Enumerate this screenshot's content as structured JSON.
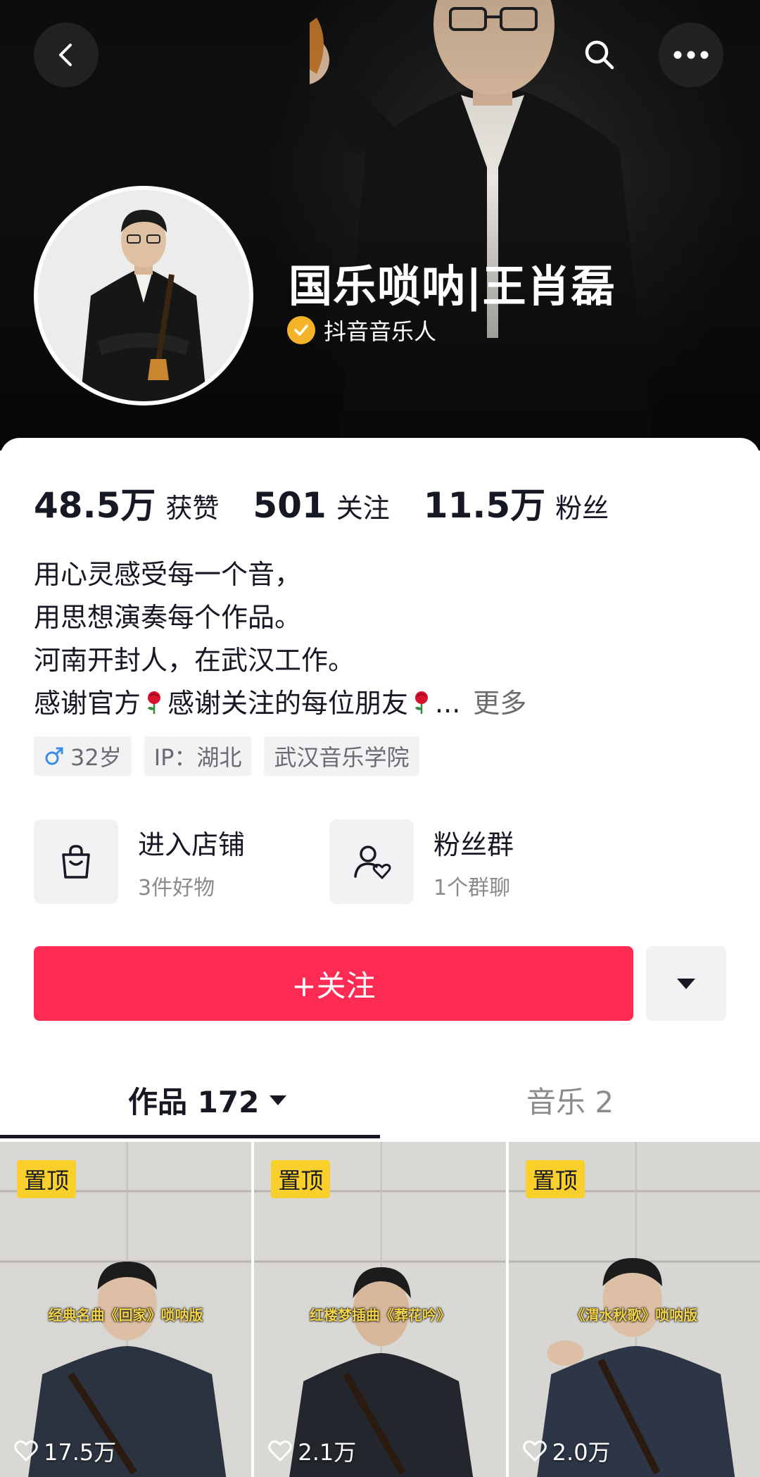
{
  "profile": {
    "name": "国乐唢呐|王肖磊",
    "verification": "抖音音乐人"
  },
  "stats": [
    {
      "value": "48.5万",
      "label": "获赞"
    },
    {
      "value": "501",
      "label": "关注"
    },
    {
      "value": "11.5万",
      "label": "粉丝"
    }
  ],
  "bio": {
    "line1": "用心灵感受每一个音，",
    "line2": "用思想演奏每个作品。",
    "line3": "河南开封人，在武汉工作。",
    "line4_a": "感谢官方",
    "line4_b": "感谢关注的每位朋友",
    "line4_c": "...",
    "more": "更多"
  },
  "tags": {
    "age": "32岁",
    "ip": "IP：湖北",
    "school": "武汉音乐学院"
  },
  "entries": {
    "shop": {
      "title": "进入店铺",
      "sub": "3件好物"
    },
    "fans_group": {
      "title": "粉丝群",
      "sub": "1个群聊"
    }
  },
  "actions": {
    "follow": "+关注"
  },
  "tabs": {
    "works": "作品 172",
    "music": "音乐 2"
  },
  "videos": [
    {
      "badge": "置顶",
      "caption": "经典名曲《回家》唢呐版",
      "likes": "17.5万"
    },
    {
      "badge": "置顶",
      "caption": "红楼梦插曲《葬花吟》",
      "likes": "2.1万"
    },
    {
      "badge": "置顶",
      "caption": "《渭水秋歌》唢呐版",
      "likes": "2.0万"
    }
  ],
  "colors": {
    "accent": "#fe2c55",
    "pin": "#f8cf2b",
    "verify": "#f5b428"
  },
  "icons": [
    "back-icon",
    "search-icon",
    "more-icon",
    "verified-icon",
    "male-icon",
    "shopping-bag-icon",
    "fan-group-icon",
    "caret-down-icon",
    "heart-icon",
    "rose-icon"
  ]
}
